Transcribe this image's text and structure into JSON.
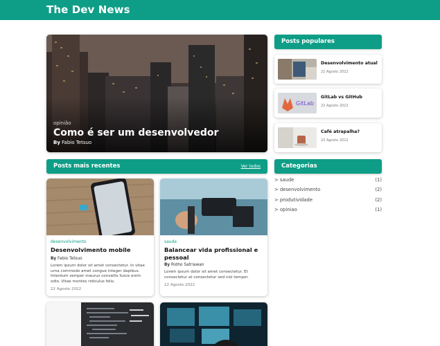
{
  "site": {
    "title": "The Dev News"
  },
  "hero": {
    "category": "opinião",
    "title": "Como é ser um desenvolvedor",
    "author_prefix": "By",
    "author": "Fabio Tetsuo"
  },
  "recent": {
    "title": "Posts mais recentes",
    "see_all": "Ver todos",
    "posts": [
      {
        "category": "desenvolvimento",
        "title": "Desenvolvimento mobile",
        "author_prefix": "By",
        "author": "Fabio Tetsuo",
        "excerpt": "Lorem ipsum dolor sit amet consectetur. In vitae urna commodo amet congue integer dapibus. Interdum semper maurus convallis fusce enim odio. Vitae montes ridiculus felis.",
        "date": "22 Agosto 2022"
      },
      {
        "category": "saude",
        "title": "Balancear vida profissional e pessoal",
        "author_prefix": "By",
        "author": "Ridho Satriawan",
        "excerpt": "Lorem ipsum dolor sit amet consectetur. Et consectetur at consectetur sed nisl tempor.",
        "date": "22 Agosto 2022"
      }
    ]
  },
  "popular": {
    "title": "Posts populares",
    "posts": [
      {
        "title": "Desenvolvimento atual",
        "date": "22 Agosto 2022"
      },
      {
        "title": "GitLab vs GitHub",
        "date": "22 Agosto 2022",
        "thumb_text": "GitLab"
      },
      {
        "title": "Café atrapalha?",
        "date": "22 Agosto 2022"
      }
    ]
  },
  "categories": {
    "title": "Categorias",
    "items": [
      {
        "name": "> saude",
        "count": "(1)"
      },
      {
        "name": "> desenvolvimento",
        "count": "(2)"
      },
      {
        "name": "> produtividade",
        "count": "(2)"
      },
      {
        "name": "> opiniao",
        "count": "(1)"
      }
    ]
  },
  "colors": {
    "brand": "#0e9e87",
    "background": "#ffffff",
    "category_text": "#0e9e87"
  }
}
